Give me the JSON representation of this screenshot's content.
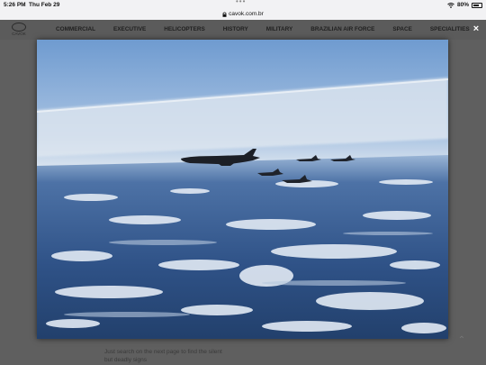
{
  "status_bar": {
    "time": "5:26 PM",
    "date": "Thu Feb 29",
    "battery": "80%",
    "battery_level": 0.8,
    "wifi_icon": "wifi-icon",
    "dots": "•••"
  },
  "browser": {
    "url": "cavok.com.br",
    "lock_icon": "lock-icon"
  },
  "site": {
    "logo_text": "CAVOK",
    "nav": [
      "COMMERCIAL",
      "EXECUTIVE",
      "HELICOPTERS",
      "HISTORY",
      "MILITARY",
      "BRAZILIAN AIR FORCE",
      "SPACE",
      "SPECIALITIES"
    ]
  },
  "lightbox": {
    "close_icon": "close-icon",
    "close_label": "×"
  },
  "article": {
    "teaser_line1": "Just search on the next page to find the silent",
    "teaser_line2": "but deadly signs"
  },
  "colors": {
    "sky_top": "#7fa8d8",
    "sky_haze": "#cfdbe8",
    "ground": "#2c4f82",
    "snow": "#e4ecf5",
    "overlay": "#5b5b5b"
  }
}
